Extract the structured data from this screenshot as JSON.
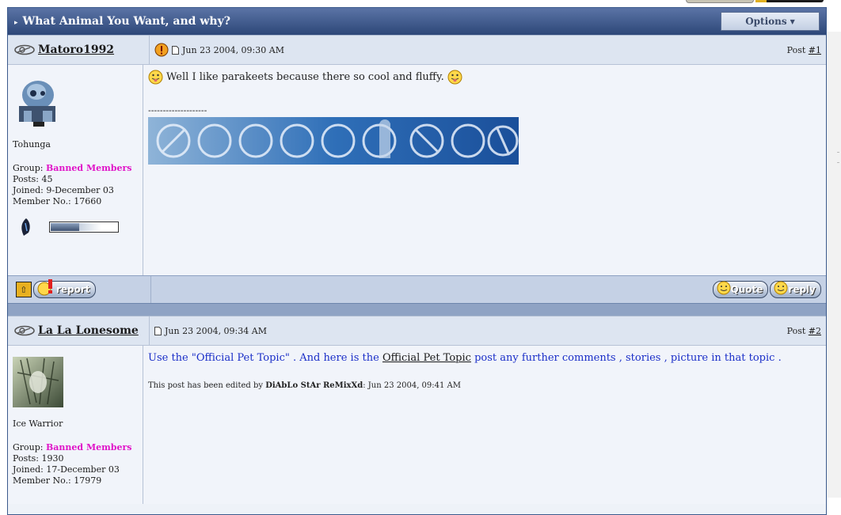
{
  "topic": {
    "title": "What Animal You Want, and why?",
    "options_label": "Options"
  },
  "posts": [
    {
      "username": "Matoro1992",
      "date": "Jun 23 2004, 09:30 AM",
      "post_label": "Post",
      "post_number": "#1",
      "rank": "Tohunga",
      "group_label": "Group:",
      "group": "Banned Members",
      "posts_line": "Posts: 45",
      "joined_line": "Joined: 9-December 03",
      "member_line": "Member No.: 17660",
      "message": "Well I like parakeets because there so cool and fluffy.",
      "sig_divider": "--------------------"
    },
    {
      "username": "La La Lonesome",
      "date": "Jun 23 2004, 09:34 AM",
      "post_label": "Post",
      "post_number": "#2",
      "rank": "Ice Warrior",
      "group_label": "Group:",
      "group": "Banned Members",
      "posts_line": "Posts: 1930",
      "joined_line": "Joined: 17-December 03",
      "member_line": "Member No.: 17979",
      "message_part1": "Use the \"Official Pet Topic\" . And here is the ",
      "message_link": "Official Pet Topic",
      "message_part2": " post any further comments , stories , picture in that topic .",
      "edited_prefix": "This post has been edited by ",
      "edited_by": "DiAbLo StAr ReMixXd",
      "edited_suffix": ": Jun 23 2004, 09:41 AM"
    }
  ],
  "buttons": {
    "report": "report",
    "quote": "Quote",
    "reply": "reply"
  },
  "colors": {
    "group_banned": "#e014c8",
    "post2_text": "#1a2ec8",
    "title_bar": "#2d4778"
  }
}
